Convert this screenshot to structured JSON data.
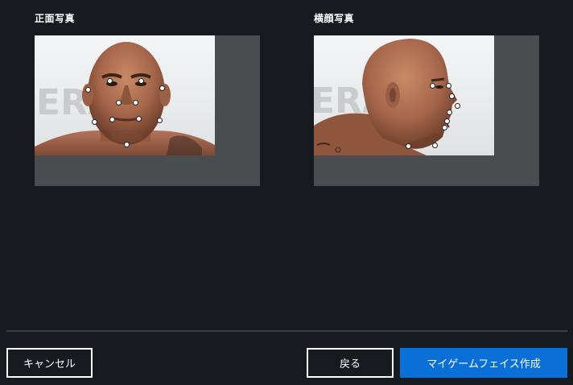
{
  "front": {
    "label": "正面写真",
    "watermark": "ERAPT"
  },
  "side": {
    "label": "横顔写真",
    "watermark": "ERAPT"
  },
  "buttons": {
    "cancel": "キャンセル",
    "back": "戻る",
    "create": "マイゲームフェイス作成"
  },
  "colors": {
    "background": "#171b1f",
    "frame": "#4a4d50",
    "primary": "#0a6fd6",
    "divider": "#3b3f44"
  }
}
